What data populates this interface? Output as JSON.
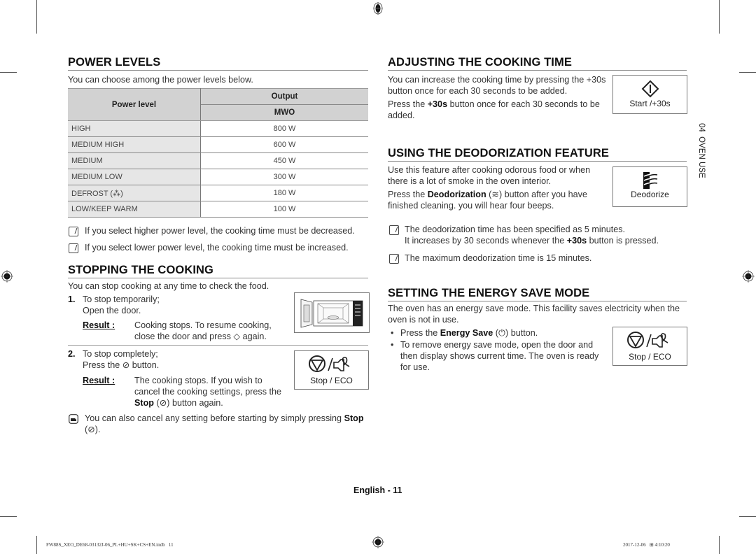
{
  "power_levels": {
    "title": "POWER LEVELS",
    "intro": "You can choose among the power levels below.",
    "table": {
      "col_power_level": "Power level",
      "col_output": "Output",
      "col_mwo": "MWO",
      "rows": [
        {
          "level": "HIGH",
          "output": "800 W"
        },
        {
          "level": "MEDIUM HIGH",
          "output": "600 W"
        },
        {
          "level": "MEDIUM",
          "output": "450 W"
        },
        {
          "level": "MEDIUM LOW",
          "output": "300 W"
        },
        {
          "level": "DEFROST (⁂)",
          "output": "180 W"
        },
        {
          "level": "LOW/KEEP WARM",
          "output": "100 W"
        }
      ]
    },
    "notes": [
      "If you select higher power level, the cooking time must be decreased.",
      "If you select lower power level, the cooking time must be increased."
    ]
  },
  "stopping": {
    "title": "STOPPING THE COOKING",
    "intro": "You can stop cooking at any time to check the food.",
    "step1_num": "1.",
    "step1_line1": "To stop temporarily;",
    "step1_line2": "Open the door.",
    "result_label": "Result :",
    "step1_result_1": "Cooking stops. To resume cooking,",
    "step1_result_2": "close the door and press",
    "step1_result_3": "again.",
    "step2_num": "2.",
    "step2_line1": "To stop completely;",
    "step2_line2a": "Press the",
    "step2_line2b": "button.",
    "step2_result_1": "The cooking stops. If you wish to",
    "step2_result_2": "cancel the cooking settings, press the",
    "step2_result_3_bold": "Stop",
    "step2_result_3_rest": "button again.",
    "tip_1": "You can also cancel any setting before starting by simply pressing",
    "tip_bold": "Stop",
    "stop_eco_label": "Stop / ECO"
  },
  "adjusting": {
    "title": "ADJUSTING THE COOKING TIME",
    "line1": "You can increase the cooking time by pressing the +30s",
    "line2": "button once for each 30 seconds to be added.",
    "line3a": "Press the",
    "line3b": "+30s",
    "line3c": "button once for each 30 seconds to be",
    "line4": "added.",
    "button_label": "Start /+30s"
  },
  "deodorization": {
    "title": "USING THE DEODORIZATION FEATURE",
    "line1": "Use this feature after cooking odorous food or when",
    "line2": "there is a lot of smoke in the oven interior.",
    "line3a": "Press the",
    "line3b": "Deodorization",
    "line3c": "button after you have",
    "line4": "finished cleaning. you will hear four beeps.",
    "button_label": "Deodorize",
    "note1_a": "The deodorization time has been specified as 5 minutes.",
    "note1_b1": "It increases by 30 seconds whenever the",
    "note1_b2": "+30s",
    "note1_b3": "button is pressed.",
    "note2": "The maximum deodorization time is 15 minutes."
  },
  "energy_save": {
    "title": "SETTING THE ENERGY SAVE MODE",
    "line1": "The oven has an energy save mode. This facility saves electricity when the",
    "line2": "oven is not in use.",
    "bullet1a": "Press the",
    "bullet1b": "Energy Save",
    "bullet1c": "button.",
    "bullet2_1": "To remove energy save mode, open the door and",
    "bullet2_2": "then display shows current time. The oven is ready",
    "bullet2_3": "for use.",
    "button_label": "Stop / ECO"
  },
  "side_tab": "04  OVEN USE",
  "page_footer": "English - 11",
  "print_footer": {
    "file": "FW88S_XEO_DE68-03132J-06_PL+HU+SK+CS+EN.indb   11",
    "timestamp": "2017-12-06   ⊞ 4:10:20"
  }
}
